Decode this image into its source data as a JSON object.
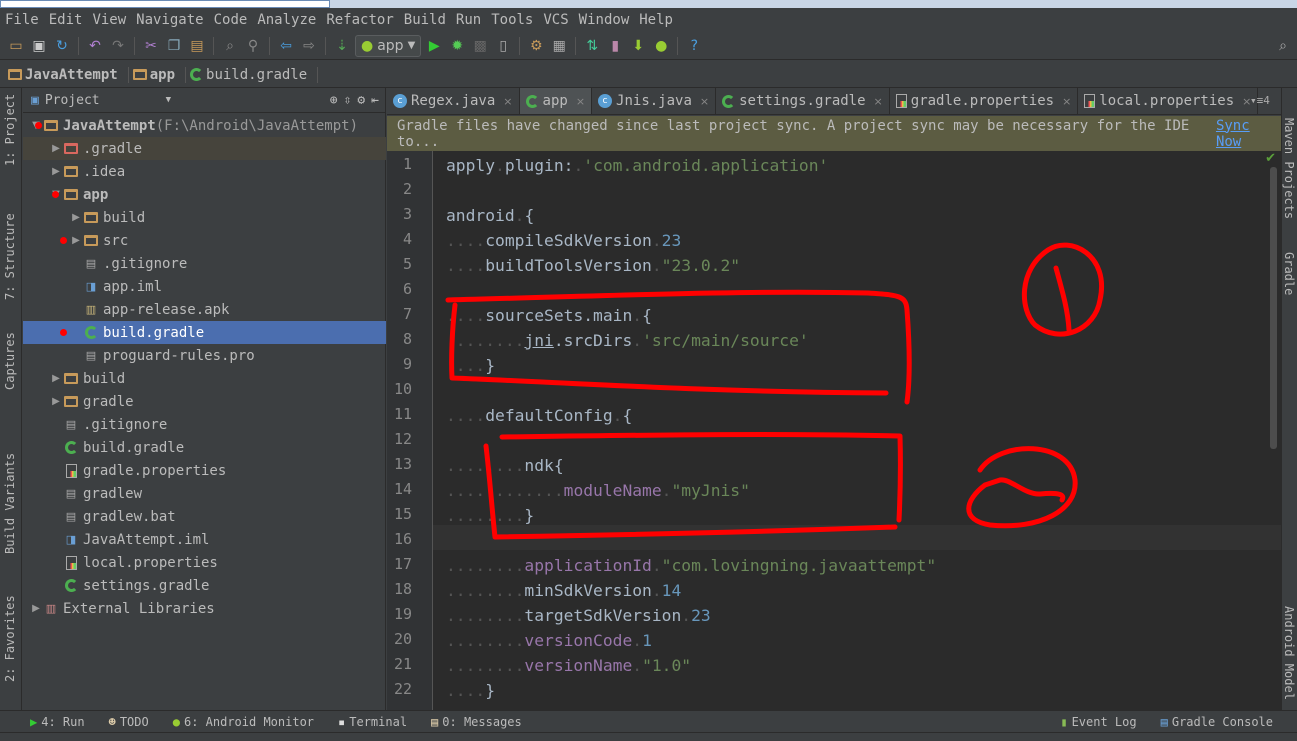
{
  "menu": [
    "File",
    "Edit",
    "View",
    "Navigate",
    "Code",
    "Analyze",
    "Refactor",
    "Build",
    "Run",
    "Tools",
    "VCS",
    "Window",
    "Help"
  ],
  "toolbar": {
    "run_config": "app"
  },
  "breadcrumb": [
    "JavaAttempt",
    "app",
    "build.gradle"
  ],
  "left_strip": [
    "1: Project",
    "7: Structure",
    "Captures",
    "Build Variants",
    "2: Favorites"
  ],
  "right_strip": [
    "Maven Projects",
    "Gradle",
    "Android Model"
  ],
  "project": {
    "view": "Project",
    "tree": [
      {
        "label": "JavaAttempt",
        "extra": " (F:\\Android\\JavaAttempt)",
        "level": 0,
        "arrow": "▼",
        "icon": "module",
        "dot": true
      },
      {
        "label": ".gradle",
        "level": 1,
        "arrow": "▶",
        "icon": "folder-red",
        "hl": true
      },
      {
        "label": ".idea",
        "level": 1,
        "arrow": "▶",
        "icon": "folder"
      },
      {
        "label": "app",
        "level": 1,
        "arrow": "▼",
        "icon": "module",
        "dot": true
      },
      {
        "label": "build",
        "level": 2,
        "arrow": "▶",
        "icon": "folder"
      },
      {
        "label": "src",
        "level": 2,
        "arrow": "▶",
        "icon": "folder",
        "dot": true
      },
      {
        "label": ".gitignore",
        "level": 2,
        "icon": "text"
      },
      {
        "label": "app.iml",
        "level": 2,
        "icon": "iml"
      },
      {
        "label": "app-release.apk",
        "level": 2,
        "icon": "apk"
      },
      {
        "label": "build.gradle",
        "level": 2,
        "icon": "gradle",
        "selected": true,
        "dot": true
      },
      {
        "label": "proguard-rules.pro",
        "level": 2,
        "icon": "text"
      },
      {
        "label": "build",
        "level": 1,
        "arrow": "▶",
        "icon": "folder"
      },
      {
        "label": "gradle",
        "level": 1,
        "arrow": "▶",
        "icon": "folder"
      },
      {
        "label": ".gitignore",
        "level": 1,
        "icon": "text"
      },
      {
        "label": "build.gradle",
        "level": 1,
        "icon": "gradle"
      },
      {
        "label": "gradle.properties",
        "level": 1,
        "icon": "properties"
      },
      {
        "label": "gradlew",
        "level": 1,
        "icon": "text"
      },
      {
        "label": "gradlew.bat",
        "level": 1,
        "icon": "text"
      },
      {
        "label": "JavaAttempt.iml",
        "level": 1,
        "icon": "iml"
      },
      {
        "label": "local.properties",
        "level": 1,
        "icon": "properties"
      },
      {
        "label": "settings.gradle",
        "level": 1,
        "icon": "gradle"
      },
      {
        "label": "External Libraries",
        "level": 0,
        "arrow": "▶",
        "icon": "library"
      }
    ]
  },
  "tabs": [
    {
      "label": "Regex.java",
      "icon": "class"
    },
    {
      "label": "app",
      "icon": "gradle",
      "active": true
    },
    {
      "label": "Jnis.java",
      "icon": "class"
    },
    {
      "label": "settings.gradle",
      "icon": "gradle"
    },
    {
      "label": "gradle.properties",
      "icon": "properties"
    },
    {
      "label": "local.properties",
      "icon": "properties"
    }
  ],
  "tabs_overflow": "▾≡4",
  "notification": {
    "text": "Gradle files have changed since last project sync. A project sync may be necessary for the IDE to...",
    "link": "Sync Now"
  },
  "code": [
    {
      "indent": 0,
      "tokens": [
        [
          "apply",
          ""
        ],
        [
          " ",
          "ws"
        ],
        [
          "plugin:",
          ""
        ],
        [
          " ",
          "ws"
        ],
        [
          "'com.android.application'",
          "s"
        ]
      ]
    },
    {
      "indent": 0,
      "tokens": []
    },
    {
      "indent": 0,
      "tokens": [
        [
          "android",
          ""
        ],
        [
          " ",
          "ws"
        ],
        [
          "{",
          ""
        ]
      ]
    },
    {
      "indent": 4,
      "tokens": [
        [
          "compileSdkVersion",
          ""
        ],
        [
          " ",
          "ws"
        ],
        [
          "23",
          "n"
        ]
      ]
    },
    {
      "indent": 4,
      "tokens": [
        [
          "buildToolsVersion",
          ""
        ],
        [
          " ",
          "ws"
        ],
        [
          "\"23.0.2\"",
          "s"
        ]
      ]
    },
    {
      "indent": 0,
      "tokens": []
    },
    {
      "indent": 4,
      "tokens": [
        [
          "sourceSets.main",
          ""
        ],
        [
          " ",
          "ws"
        ],
        [
          "{",
          ""
        ]
      ]
    },
    {
      "indent": 8,
      "tokens": [
        [
          "jni",
          "u"
        ],
        [
          ".srcDirs",
          ""
        ],
        [
          " ",
          "ws"
        ],
        [
          "'src/main/source'",
          "s"
        ]
      ]
    },
    {
      "indent": 4,
      "tokens": [
        [
          "}",
          ""
        ]
      ]
    },
    {
      "indent": 0,
      "tokens": []
    },
    {
      "indent": 4,
      "tokens": [
        [
          "defaultConfig",
          ""
        ],
        [
          " ",
          "ws"
        ],
        [
          "{",
          ""
        ]
      ]
    },
    {
      "indent": 0,
      "tokens": []
    },
    {
      "indent": 8,
      "tokens": [
        [
          "ndk{",
          ""
        ]
      ]
    },
    {
      "indent": 12,
      "tokens": [
        [
          "moduleName",
          "p"
        ],
        [
          " ",
          "ws"
        ],
        [
          "\"myJnis\"",
          "s"
        ]
      ]
    },
    {
      "indent": 8,
      "tokens": [
        [
          "}",
          ""
        ]
      ]
    },
    {
      "indent": 0,
      "tokens": []
    },
    {
      "indent": 8,
      "tokens": [
        [
          "applicationId",
          "p"
        ],
        [
          " ",
          "ws"
        ],
        [
          "\"com.lovingning.javaattempt\"",
          "s"
        ]
      ]
    },
    {
      "indent": 8,
      "tokens": [
        [
          "minSdkVersion",
          ""
        ],
        [
          " ",
          "ws"
        ],
        [
          "14",
          "n"
        ]
      ]
    },
    {
      "indent": 8,
      "tokens": [
        [
          "targetSdkVersion",
          ""
        ],
        [
          " ",
          "ws"
        ],
        [
          "23",
          "n"
        ]
      ]
    },
    {
      "indent": 8,
      "tokens": [
        [
          "versionCode",
          "p"
        ],
        [
          " ",
          "ws"
        ],
        [
          "1",
          "n"
        ]
      ]
    },
    {
      "indent": 8,
      "tokens": [
        [
          "versionName",
          "p"
        ],
        [
          " ",
          "ws"
        ],
        [
          "\"1.0\"",
          "s"
        ]
      ]
    },
    {
      "indent": 4,
      "tokens": [
        [
          "}",
          ""
        ]
      ]
    }
  ],
  "bottom_tools": [
    {
      "label": "4: Run",
      "icon": "run-icon"
    },
    {
      "label": "TODO",
      "icon": "todo-icon"
    },
    {
      "label": "6: Android Monitor",
      "icon": "android-icon"
    },
    {
      "label": "Terminal",
      "icon": "terminal-icon"
    },
    {
      "label": "0: Messages",
      "icon": "messages-icon"
    }
  ],
  "bottom_tools_right": [
    {
      "label": "Event Log",
      "icon": "event-log-icon"
    },
    {
      "label": "Gradle Console",
      "icon": "gradle-console-icon"
    }
  ],
  "colors": {
    "editor_bg": "#2b2b2b",
    "panel_bg": "#3c3f41",
    "selection": "#4b6eaf",
    "annotation": "#ff0000",
    "string": "#6a8759",
    "number": "#6897bb",
    "property": "#9876aa"
  }
}
